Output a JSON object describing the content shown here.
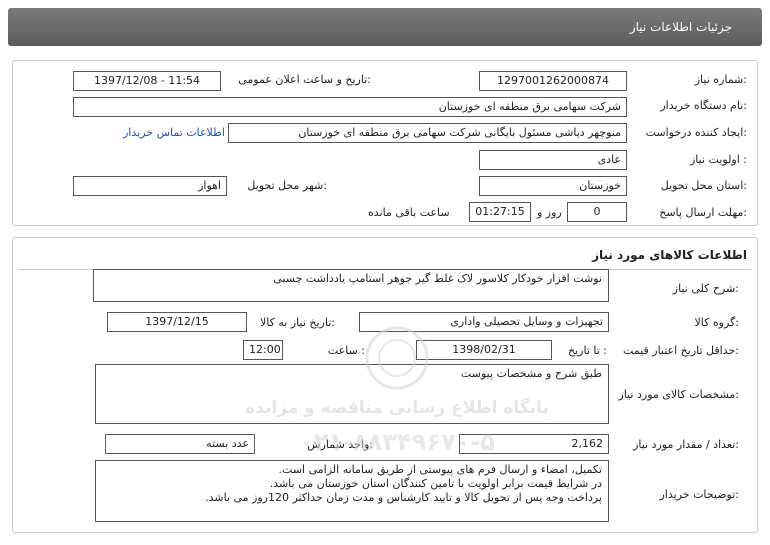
{
  "header": {
    "title": "جزئیات اطلاعات نیاز"
  },
  "need_info": {
    "need_number_label": "شماره نیاز:",
    "need_number": "1297001262000874",
    "announce_label": "تاریخ و ساعت اعلان عمومی:",
    "announce_value": "1397/12/08 - 11:54",
    "buyer_org_label": "نام دستگاه خریدار:",
    "buyer_org": "شرکت سهامی برق منطقه ای خوزستان",
    "requester_label": "ایجاد کننده درخواست:",
    "requester": "منوچهر دیاشی مسئول بایگانی شرکت سهامی برق منطقه ای خوزستان",
    "contact_link": "اطلاعات تماس خریدار",
    "priority_label": "اولویت نیاز :",
    "priority": "عادی",
    "province_label": "استان محل تحویل:",
    "province": "خوزستان",
    "city_label": "شهر محل تحویل:",
    "city": "اهواز",
    "deadline_label": "مهلت ارسال پاسخ:",
    "deadline_days": "0",
    "deadline_days_unit": "روز و",
    "deadline_time": "01:27:15",
    "deadline_remaining": "ساعت باقی مانده"
  },
  "goods": {
    "section_title": "اطلاعات کالاهای مورد نیاز",
    "general_desc_label": "شرح کلی نیاز:",
    "general_desc": "نوشت افزار خودکار کلاسور لاک غلط گیر جوهر استامپ یادداشت چسبی",
    "group_label": "گروه کالا:",
    "group": "تجهیزات و وسایل تحصیلی واداری",
    "need_date_label": "تاریخ نیاز به کالا:",
    "need_date": "1397/12/15",
    "validity_label": "حداقل تاریخ اعتبار قیمت:",
    "validity_to_label": "تا تاریخ :",
    "validity_date": "1398/02/31",
    "time_label": "ساعت :",
    "validity_time": "12:00",
    "specs_label": "مشخصات کالای مورد نیاز:",
    "specs": "طبق شرح و مشخصات پیوست",
    "qty_label": "تعداد / مقدار مورد نیاز:",
    "qty": "2,162",
    "unit_label": "واحد شمارش:",
    "unit": "عدد بسته",
    "buyer_notes_label": "توضیحات خریدار:",
    "buyer_notes": [
      "تکمیل، امضاء و ارسال فرم های پیوستی از طریق سامانه الزامی است.",
      "در شرایط  قیمت برابر اولویت با تامین کنندگان استان خوزستان می باشد.",
      "پرداخت وجه پس از تحویل کالا و تایید کارشناس و مدت زمان حداکثر 120روز می باشد."
    ]
  },
  "watermark": {
    "line1": "پایگاه اطلاع رسانی مناقصه و مزایده",
    "line2": "۰۲۱-۸۸۳۴۹۶۷۰-۵"
  }
}
